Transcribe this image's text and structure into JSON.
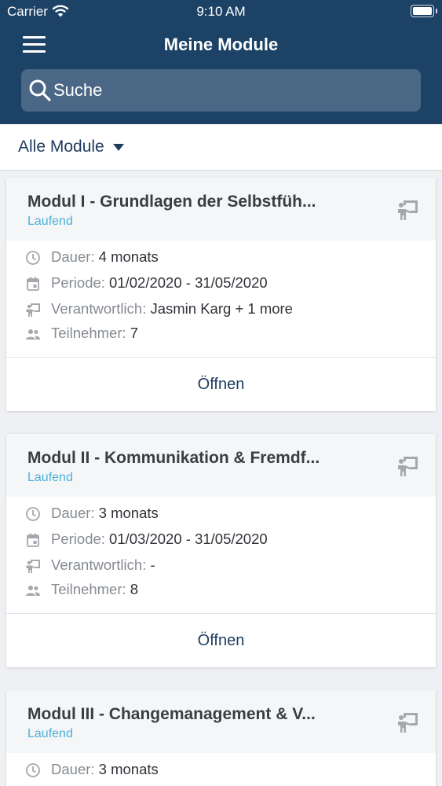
{
  "status_bar": {
    "carrier": "Carrier",
    "time": "9:10 AM"
  },
  "header": {
    "title": "Meine Module"
  },
  "search": {
    "placeholder": "Suche"
  },
  "filter": {
    "label": "Alle Module"
  },
  "row_labels": {
    "duration": "Dauer:",
    "period": "Periode:",
    "responsible": "Verantwortlich:",
    "participants": "Teilnehmer:"
  },
  "modules": [
    {
      "title": "Modul I - Grundlagen der Selbstfüh...",
      "status": "Laufend",
      "duration": "4 monats",
      "period": "01/02/2020 - 31/05/2020",
      "responsible": "Jasmin Karg + 1 more",
      "participants": "7",
      "open_label": "Öffnen"
    },
    {
      "title": "Modul II - Kommunikation & Fremdf...",
      "status": "Laufend",
      "duration": "3 monats",
      "period": "01/03/2020 - 31/05/2020",
      "responsible": "-",
      "participants": "8",
      "open_label": "Öffnen"
    },
    {
      "title": "Modul III - Changemanagement & V...",
      "status": "Laufend",
      "duration": "3 monats"
    }
  ],
  "icons": {
    "menu": "hamburger-menu-icon",
    "search": "search-icon",
    "filter": "caret-down-icon",
    "card": "teacher-board-icon",
    "duration": "clock-icon",
    "period": "calendar-icon",
    "responsible": "teacher-icon",
    "participants": "people-icon"
  },
  "colors": {
    "header_bg": "#1c4266",
    "search_bg": "#4a6786",
    "status_accent": "#4ab0d9",
    "action_text": "#1d3c5e"
  }
}
